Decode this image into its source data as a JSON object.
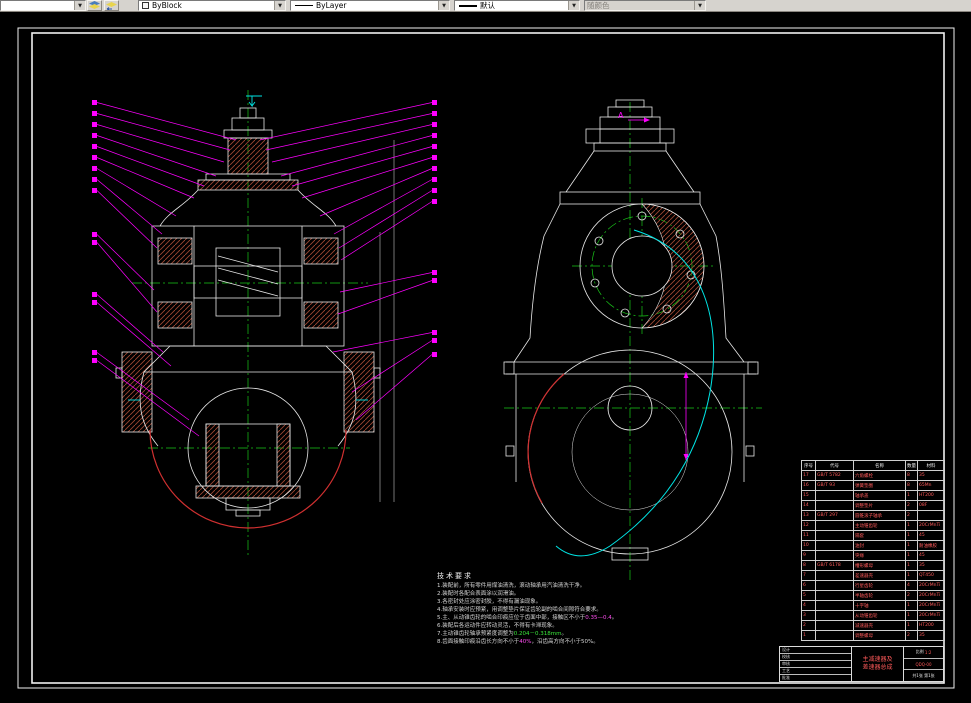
{
  "toolbar": {
    "layer_value": "",
    "color_value": "ByBlock",
    "linetype_value": "ByLayer",
    "lineweight_value": "默认",
    "plotstyle_value": "随颜色"
  },
  "drawing": {
    "section_label": "A",
    "tech": {
      "title": "技术要求",
      "items": [
        {
          "pre": "1.装配前，所有零件用煤油清洗，滚动轴承用汽油清洗干净。",
          "hl": "",
          "post": ""
        },
        {
          "pre": "2.装配时各配合表面涂以润滑油。",
          "hl": "",
          "post": ""
        },
        {
          "pre": "3.各密封处应涂密封胶，不得有漏油现象。",
          "hl": "",
          "post": ""
        },
        {
          "pre": "4.轴承安装时应预紧，用调整垫片保证齿轮副的啮合间隙符合要求。",
          "hl": "",
          "post": ""
        },
        {
          "pre": "5.主、从动锥齿轮的啮合印痕应位于齿面中部，接触区不小于",
          "hl": "0.35—0.4",
          "post": "。"
        },
        {
          "pre": "6.装配后各运动件应转动灵活，不得有卡滞现象。",
          "hl": "",
          "post": ""
        },
        {
          "pre": "7.主动锥齿轮轴承预紧度调整为",
          "hl": "0.204－0.318mm",
          "post": "。"
        },
        {
          "pre": "8.齿面接触印痕沿齿长方向不小于",
          "hl": "40%",
          "post": "，沿齿高方向不小于50%。"
        }
      ]
    },
    "bom": {
      "headers": [
        "序号",
        "代号",
        "名称",
        "数量",
        "材料"
      ],
      "rows": [
        [
          "17",
          "GB/T 5782",
          "六角螺栓",
          "8",
          "35"
        ],
        [
          "16",
          "GB/T 93",
          "弹簧垫圈",
          "8",
          "65Mn"
        ],
        [
          "15",
          "",
          "轴承盖",
          "1",
          "HT200"
        ],
        [
          "14",
          "",
          "调整垫片",
          "2",
          "08F"
        ],
        [
          "13",
          "GB/T 297",
          "圆锥滚子轴承",
          "2",
          ""
        ],
        [
          "12",
          "",
          "主动锥齿轮",
          "1",
          "20CrMnTi"
        ],
        [
          "11",
          "",
          "隔套",
          "1",
          "45"
        ],
        [
          "10",
          "",
          "油封",
          "1",
          "耐油橡胶"
        ],
        [
          "9",
          "",
          "突缘",
          "1",
          "45"
        ],
        [
          "8",
          "GB/T 6178",
          "槽形螺母",
          "1",
          "35"
        ],
        [
          "7",
          "",
          "差速器壳",
          "1",
          "QT450"
        ],
        [
          "6",
          "",
          "行星齿轮",
          "4",
          "20CrMnTi"
        ],
        [
          "5",
          "",
          "半轴齿轮",
          "2",
          "20CrMnTi"
        ],
        [
          "4",
          "",
          "十字轴",
          "1",
          "20CrMnTi"
        ],
        [
          "3",
          "",
          "从动锥齿轮",
          "1",
          "20CrMnTi"
        ],
        [
          "2",
          "",
          "减速器壳",
          "1",
          "HT200"
        ],
        [
          "1",
          "",
          "调整螺母",
          "2",
          "35"
        ]
      ]
    },
    "titleblock": {
      "rows_left": [
        "设计",
        "校核",
        "审核",
        "工艺",
        "批准"
      ],
      "name_line1": "主减速器及",
      "name_line2": "差速器总成",
      "scale_label": "比例",
      "scale": "1:2",
      "drawing_no": "QDQ-00",
      "sheet": "共1张 第1张"
    }
  }
}
